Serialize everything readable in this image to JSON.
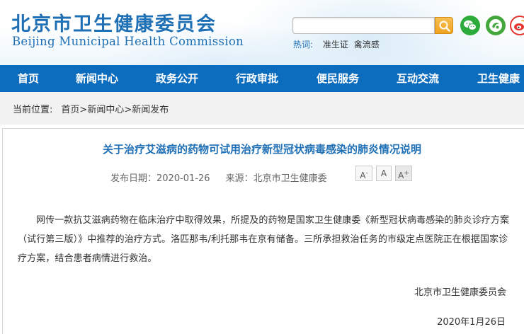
{
  "header": {
    "logo_cn": "北京市卫生健康委员会",
    "logo_en": "Beijing Municipal Health Commission",
    "search": {
      "value": "",
      "placeholder": ""
    },
    "hotwords_label": "热词:",
    "hotwords": [
      "准生证",
      "禽流感"
    ],
    "social": [
      "wechat-icon",
      "app-icon",
      "weibo-icon"
    ]
  },
  "nav": {
    "items": [
      "首页",
      "新闻中心",
      "政务公开",
      "行政审批",
      "便民服务",
      "互动交流",
      "卫生健康"
    ]
  },
  "breadcrumb": {
    "current_label": "当前位置:",
    "items": [
      "首页",
      "新闻中心",
      "新闻发布"
    ],
    "separator": ">"
  },
  "article": {
    "title": "关于治疗艾滋病的药物可试用治疗新型冠状病毒感染的肺炎情况说明",
    "publish_date": "发布日期：2020-01-26",
    "source": "来源：北京市卫生健康委",
    "font_small": "A",
    "font_mid": "A",
    "font_large": "A",
    "font_large_sup": "+",
    "body": "网传一款抗艾滋病药物在临床治疗中取得效果，所提及的药物是国家卫生健康委《新型冠状病毒感染的肺炎诊疗方案（试行第三版）》中推荐的治疗方式。洛匹那韦/利托那韦在京有储备。三所承担救治任务的市级定点医院正在根据国家诊疗方案，结合患者病情进行救治。",
    "signature": "北京市卫生健康委员会",
    "date": "2020年1月26日"
  },
  "colors": {
    "brand_blue": "#1f6fb5",
    "nav_blue": "#0c6dbe",
    "search_orange": "#eea21f"
  }
}
